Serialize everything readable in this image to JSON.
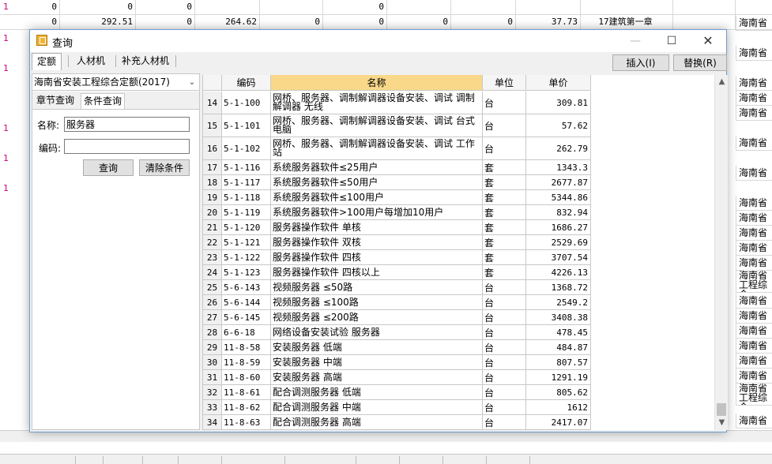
{
  "background": {
    "rows": [
      {
        "mark": "1",
        "cells": [
          "0",
          "0",
          "0",
          "",
          "",
          "0",
          "",
          "",
          "",
          "",
          ""
        ]
      },
      {
        "mark": "",
        "cells": [
          "0",
          "292.51",
          "0",
          "264.62",
          "0",
          "0",
          "0",
          "0",
          "37.73",
          "17建筑第一章",
          ""
        ]
      }
    ],
    "left_marks": [
      "1",
      "1",
      "1",
      "1",
      "1"
    ],
    "right_column": [
      "海南省",
      "海南省",
      "海南省",
      "海南省",
      "海南省",
      "海南省",
      "海南省",
      "海南省",
      "海南省",
      "海南省",
      "海南省",
      "海南省",
      "海南省",
      "海南省",
      "海南省",
      "海南省",
      "海南省",
      "海南省",
      "海南省",
      "海南省",
      "海南省",
      "海南省"
    ],
    "right_column_multi": [
      "海南省工程综合",
      "海南省工程综合"
    ]
  },
  "dialog": {
    "title": "查询",
    "window_controls": {
      "minimize": "—",
      "maximize": "☐",
      "close": "✕"
    },
    "tabs": [
      "定额",
      "人材机",
      "补充人材机"
    ],
    "insert_button": "插入(I)",
    "replace_button": "替换(R)",
    "quota_library": "海南省安装工程综合定额(2017)",
    "subtabs": [
      "章节查询",
      "条件查询"
    ],
    "form": {
      "name_label": "名称:",
      "name_value": "服务器",
      "code_label": "编码:",
      "code_value": "",
      "query_button": "查询",
      "clear_button": "清除条件"
    },
    "grid": {
      "headers": [
        "编码",
        "名称",
        "单位",
        "单价"
      ],
      "rows": [
        {
          "idx": "14",
          "code": "5-1-100",
          "name": "网桥、服务器、调制解调器设备安装、调试 调制解调器 无线",
          "unit": "台",
          "price": "309.81"
        },
        {
          "idx": "15",
          "code": "5-1-101",
          "name": "网桥、服务器、调制解调器设备安装、调试 台式电脑",
          "unit": "台",
          "price": "57.62"
        },
        {
          "idx": "16",
          "code": "5-1-102",
          "name": "网桥、服务器、调制解调器设备安装、调试 工作站",
          "unit": "台",
          "price": "262.79"
        },
        {
          "idx": "17",
          "code": "5-1-116",
          "name": "系统服务器软件≤25用户",
          "unit": "套",
          "price": "1343.3"
        },
        {
          "idx": "18",
          "code": "5-1-117",
          "name": "系统服务器软件≤50用户",
          "unit": "套",
          "price": "2677.87"
        },
        {
          "idx": "19",
          "code": "5-1-118",
          "name": "系统服务器软件≤100用户",
          "unit": "套",
          "price": "5344.86"
        },
        {
          "idx": "20",
          "code": "5-1-119",
          "name": "系统服务器软件>100用户每增加10用户",
          "unit": "套",
          "price": "832.94"
        },
        {
          "idx": "21",
          "code": "5-1-120",
          "name": "服务器操作软件 单核",
          "unit": "套",
          "price": "1686.27"
        },
        {
          "idx": "22",
          "code": "5-1-121",
          "name": "服务器操作软件 双核",
          "unit": "套",
          "price": "2529.69"
        },
        {
          "idx": "23",
          "code": "5-1-122",
          "name": "服务器操作软件 四核",
          "unit": "套",
          "price": "3707.54"
        },
        {
          "idx": "24",
          "code": "5-1-123",
          "name": "服务器操作软件 四核以上",
          "unit": "套",
          "price": "4226.13"
        },
        {
          "idx": "25",
          "code": "5-6-143",
          "name": "视频服务器 ≤50路",
          "unit": "台",
          "price": "1368.72"
        },
        {
          "idx": "26",
          "code": "5-6-144",
          "name": "视频服务器 ≤100路",
          "unit": "台",
          "price": "2549.2"
        },
        {
          "idx": "27",
          "code": "5-6-145",
          "name": "视频服务器 ≤200路",
          "unit": "台",
          "price": "3408.38"
        },
        {
          "idx": "28",
          "code": "6-6-18",
          "name": "网络设备安装试验 服务器",
          "unit": "台",
          "price": "478.45"
        },
        {
          "idx": "29",
          "code": "11-8-58",
          "name": "安装服务器 低端",
          "unit": "台",
          "price": "484.87"
        },
        {
          "idx": "30",
          "code": "11-8-59",
          "name": "安装服务器 中端",
          "unit": "台",
          "price": "807.57"
        },
        {
          "idx": "31",
          "code": "11-8-60",
          "name": "安装服务器 高端",
          "unit": "台",
          "price": "1291.19"
        },
        {
          "idx": "32",
          "code": "11-8-61",
          "name": "配合调测服务器 低端",
          "unit": "台",
          "price": "805.62"
        },
        {
          "idx": "33",
          "code": "11-8-62",
          "name": "配合调测服务器 中端",
          "unit": "台",
          "price": "1612"
        },
        {
          "idx": "34",
          "code": "11-8-63",
          "name": "配合调测服务器 高端",
          "unit": "台",
          "price": "2417.07"
        }
      ]
    }
  }
}
